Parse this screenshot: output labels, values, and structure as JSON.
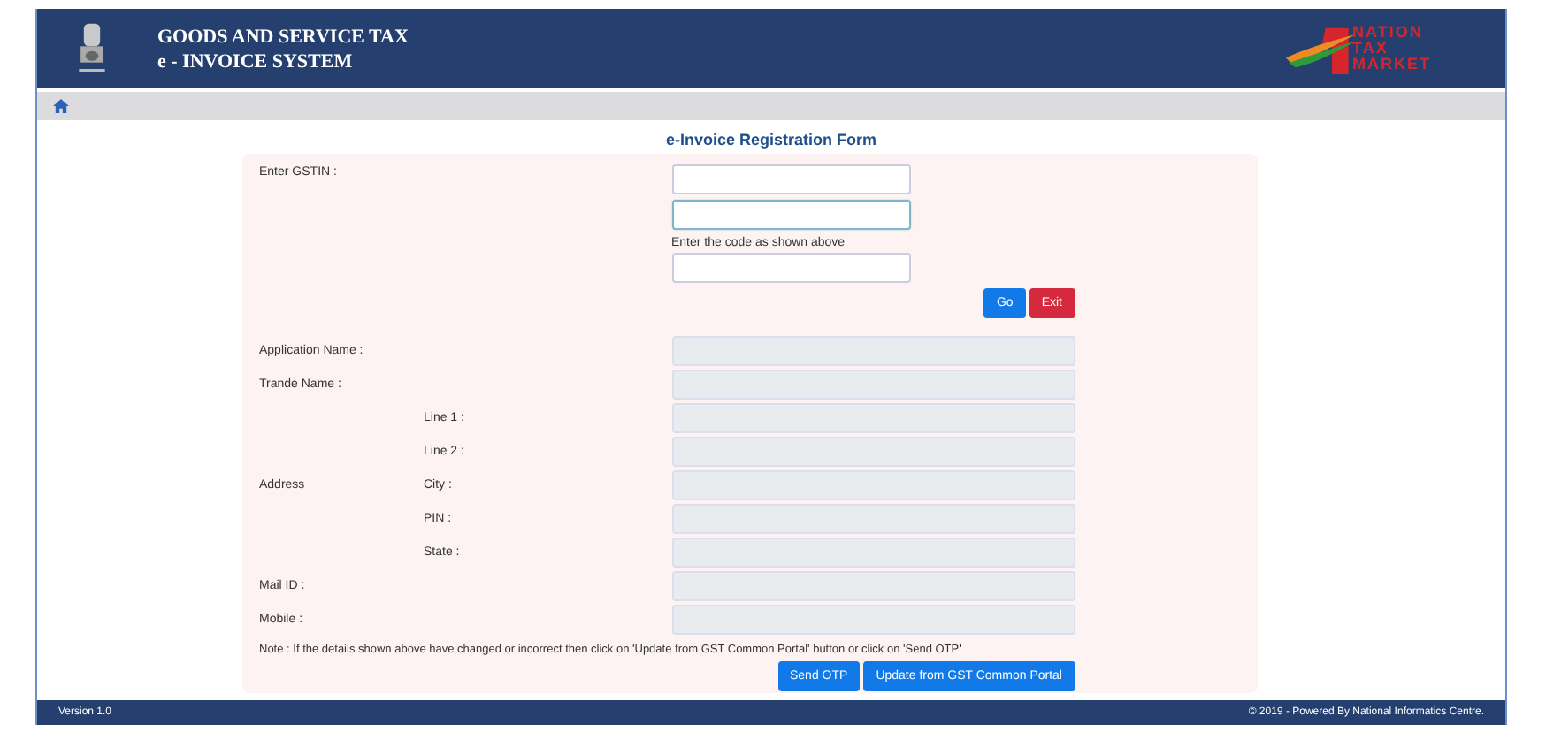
{
  "header": {
    "title_lines": [
      "GOODS AND SERVICE TAX",
      "e - INVOICE SYSTEM"
    ],
    "logo_lines": [
      "NATION",
      "TAX",
      "MARKET"
    ]
  },
  "form": {
    "title": "e-Invoice Registration Form",
    "gstin": {
      "label": "Enter GSTIN :",
      "inputs": [
        {
          "focused": false
        },
        {
          "focused": true
        }
      ]
    },
    "captcha": {
      "hint": "Enter the code as shown above",
      "focused": false
    },
    "buttons": [
      {
        "label": "Go",
        "kind": "primary"
      },
      {
        "label": "Exit",
        "kind": "danger"
      }
    ],
    "details": [
      {
        "kind": "field",
        "label": "Application Name :",
        "disabled": true
      },
      {
        "kind": "field",
        "label": "Trande Name :",
        "disabled": true
      },
      {
        "kind": "group",
        "label": "Address",
        "lines": [
          {
            "label": "Line 1 :",
            "disabled": true
          },
          {
            "label": "Line 2 :",
            "disabled": true
          },
          {
            "label": "City :",
            "disabled": true
          },
          {
            "label": "PIN :",
            "disabled": true
          },
          {
            "label": "State :",
            "disabled": true
          }
        ]
      },
      {
        "kind": "field",
        "label": "Mail ID :",
        "disabled": true
      },
      {
        "kind": "field",
        "label": "Mobile :",
        "disabled": true
      }
    ],
    "note": "Note : If the details shown above have changed or incorrect then click on 'Update from GST Common Portal' button or click on 'Send OTP'",
    "actions": [
      {
        "label": "Send OTP",
        "kind": "primary"
      },
      {
        "label": "Update from GST Common Portal",
        "kind": "primary"
      }
    ]
  },
  "footer": {
    "version": "Version 1.0",
    "credit": "© 2019 - Powered By National Informatics Centre."
  }
}
